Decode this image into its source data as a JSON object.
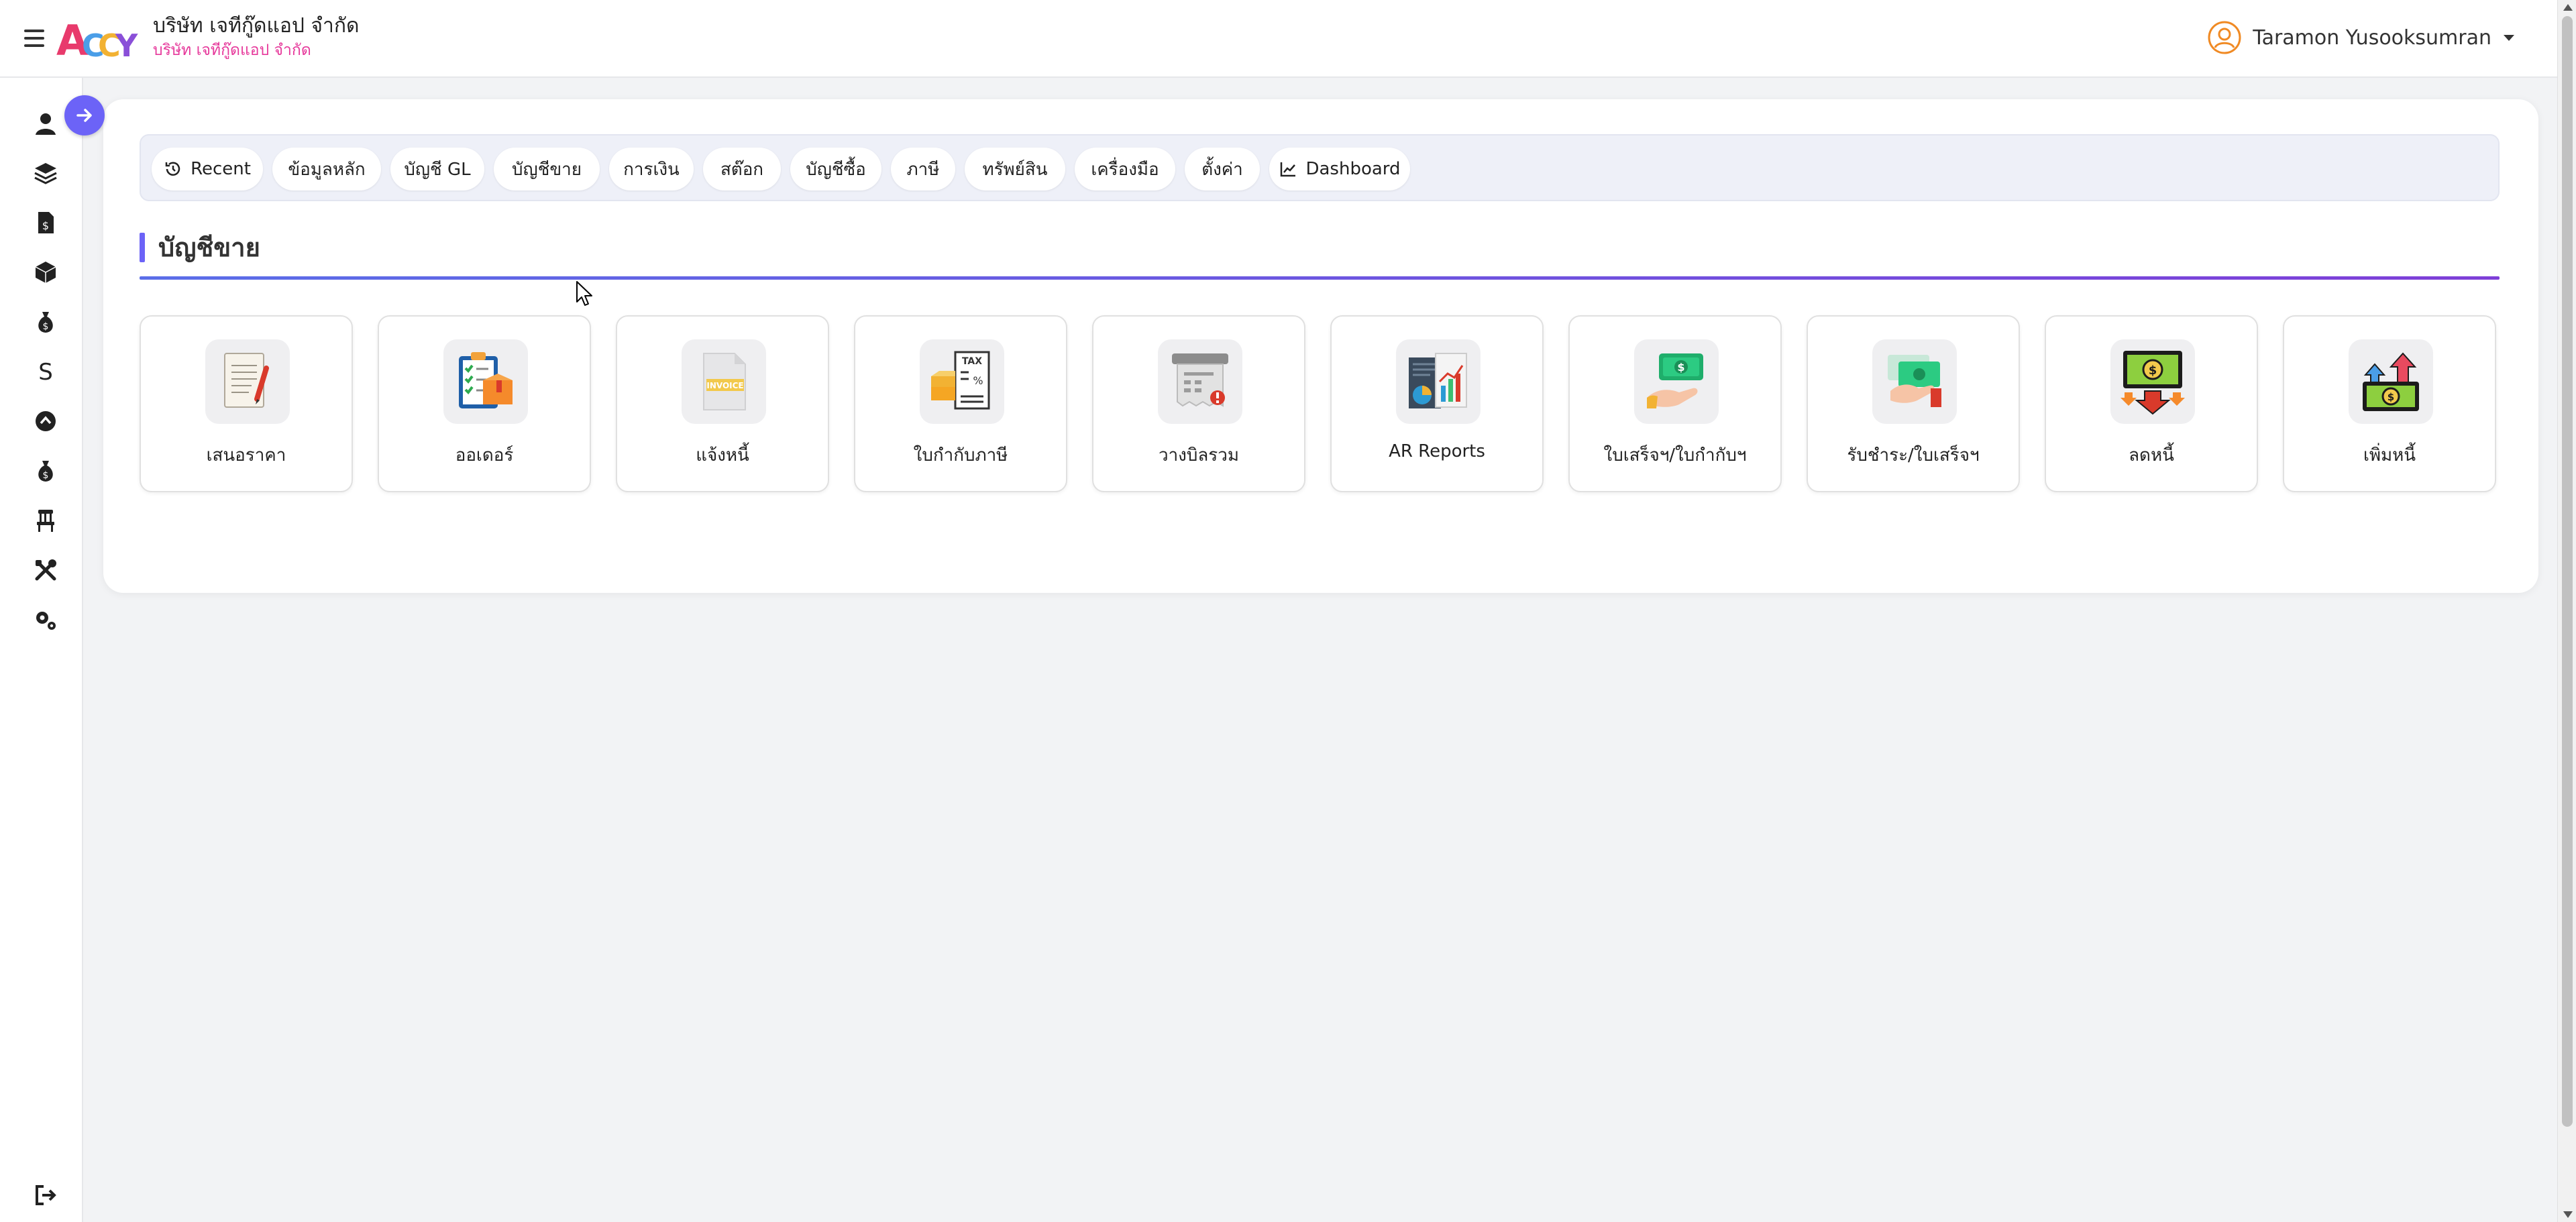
{
  "header": {
    "logo_text": "ACCY",
    "company_name": "บริษัท เจทีกู๊ดแอป จำกัด",
    "company_sub": "บริษัท เจทีกู๊ดแอป จำกัด",
    "user_name": "Taramon Yusooksumran"
  },
  "sidebar": {
    "items": [
      {
        "icon": "user-icon"
      },
      {
        "icon": "layers-icon"
      },
      {
        "icon": "invoice-icon"
      },
      {
        "icon": "cube-icon"
      },
      {
        "icon": "money-bag-icon"
      },
      {
        "icon": "dollar-icon",
        "glyph": "S"
      },
      {
        "icon": "up-circle-icon"
      },
      {
        "icon": "money-bag-icon"
      },
      {
        "icon": "chair-icon"
      },
      {
        "icon": "tools-icon"
      },
      {
        "icon": "cogs-icon"
      },
      {
        "icon": "logout-icon"
      }
    ]
  },
  "tabs": [
    {
      "label": "Recent",
      "icon": "history-icon"
    },
    {
      "label": "ข้อมูลหลัก"
    },
    {
      "label": "บัญชี GL"
    },
    {
      "label": "บัญชีขาย"
    },
    {
      "label": "การเงิน"
    },
    {
      "label": "สต๊อก"
    },
    {
      "label": "บัญชีซื้อ"
    },
    {
      "label": "ภาษี"
    },
    {
      "label": "ทรัพย์สิน"
    },
    {
      "label": "เครื่องมือ"
    },
    {
      "label": "ตั้งค่า"
    },
    {
      "label": "Dashboard",
      "icon": "chart-line-icon"
    }
  ],
  "section": {
    "title": "บัญชีขาย"
  },
  "tiles": [
    {
      "label": "เสนอราคา",
      "icon": "quotation-icon"
    },
    {
      "label": "ออเดอร์",
      "icon": "order-icon"
    },
    {
      "label": "แจ้งหนี้",
      "icon": "invoice-icon",
      "icon_text": "INVOICE"
    },
    {
      "label": "ใบกำกับภาษี",
      "icon": "tax-invoice-icon",
      "icon_text": "TAX"
    },
    {
      "label": "วางบิลรวม",
      "icon": "billing-icon"
    },
    {
      "label": "AR Reports",
      "icon": "report-chart-icon"
    },
    {
      "label": "ใบเสร็จฯ/ใบกำกับฯ",
      "icon": "receipt-money-icon"
    },
    {
      "label": "รับชำระ/ใบเสร็จฯ",
      "icon": "payment-receive-icon"
    },
    {
      "label": "ลดหนี้",
      "icon": "credit-note-icon"
    },
    {
      "label": "เพิ่มหนี้",
      "icon": "debit-note-icon"
    }
  ],
  "colors": {
    "accent": "#6c63f7",
    "brand_pink": "#e6399b",
    "user_orange": "#f08a24"
  }
}
